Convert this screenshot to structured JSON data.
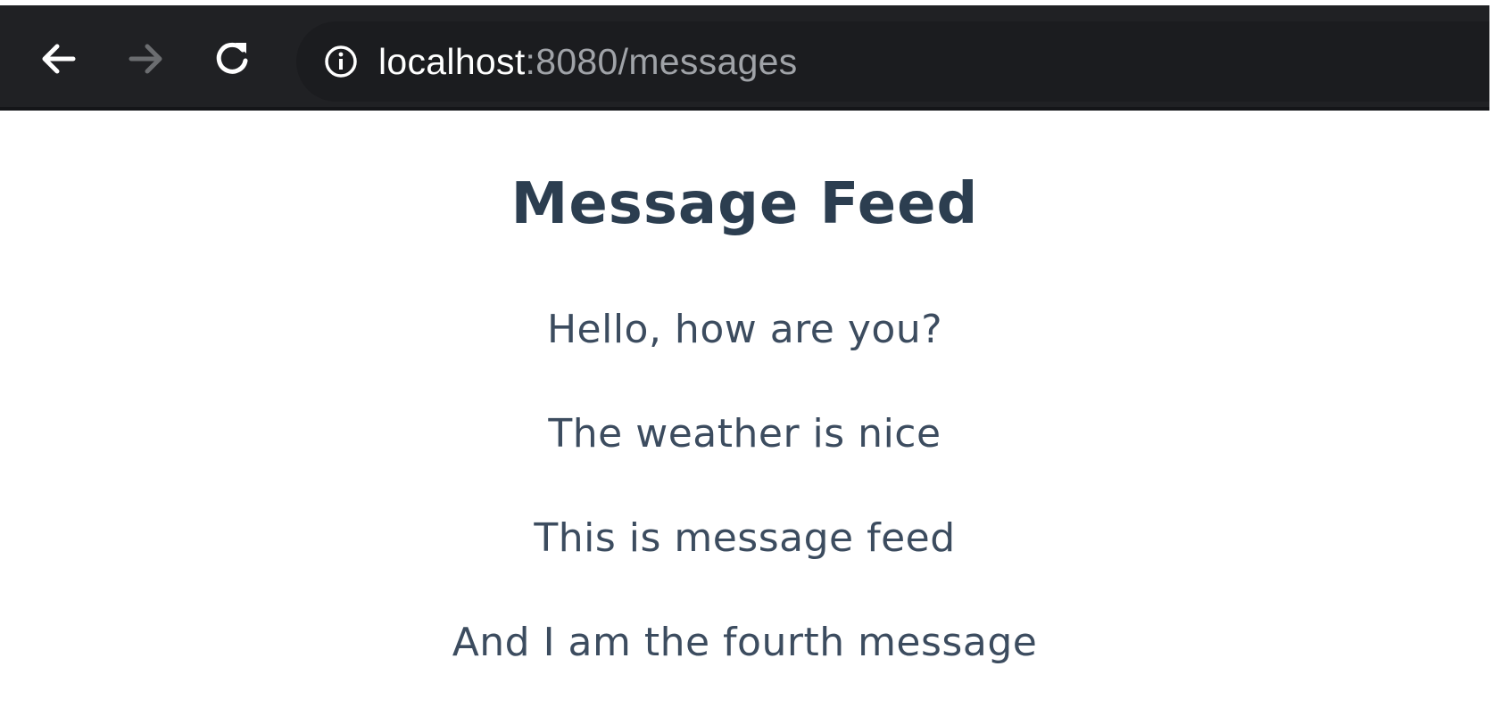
{
  "browser": {
    "back_icon": "arrow-left-icon",
    "forward_icon": "arrow-right-icon",
    "reload_icon": "reload-icon",
    "info_icon": "info-icon",
    "url_host": "localhost",
    "url_path": ":8080/messages",
    "colors": {
      "toolbar": "#202124",
      "url_host": "#ffffff",
      "url_path": "#a0a3a8",
      "forward_disabled": "#6b6d70"
    }
  },
  "page": {
    "title": "Message Feed",
    "messages": [
      "Hello, how are you?",
      "The weather is nice",
      "This is message feed",
      "And I am the fourth message"
    ],
    "colors": {
      "title": "#2c3e50",
      "text": "#3c4c5f",
      "background": "#ffffff"
    }
  }
}
